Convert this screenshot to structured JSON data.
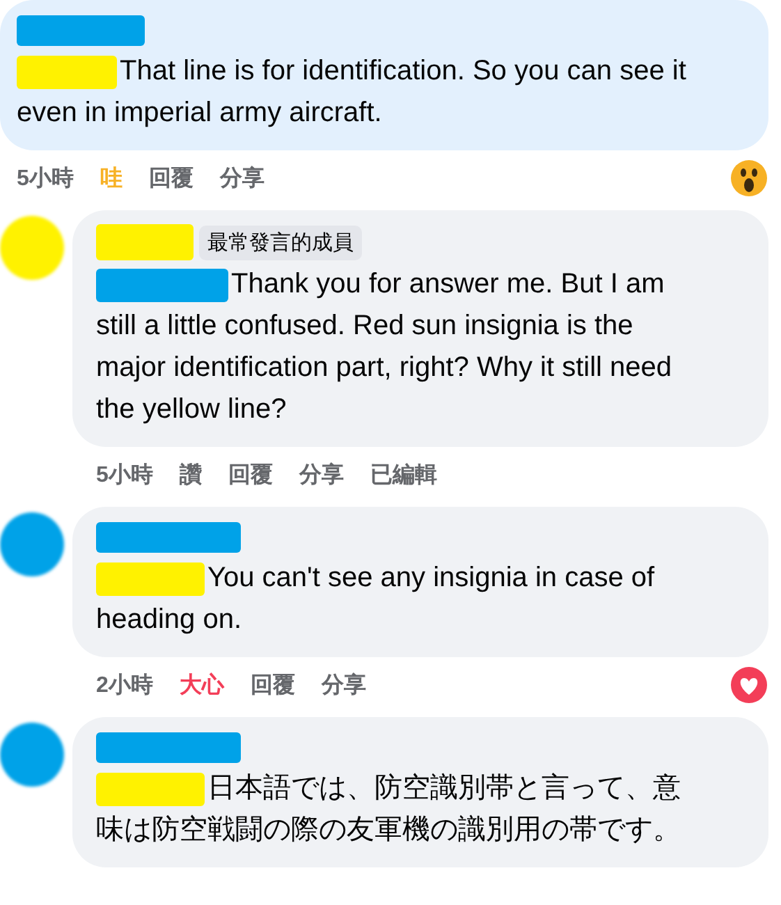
{
  "comments": [
    {
      "highlighted": true,
      "text": "That line is for identification. So you can see it even in imperial army aircraft.",
      "actions": {
        "time": "5小時",
        "reaction": {
          "label": "哇",
          "color": "#f7b125",
          "kind": "wow"
        },
        "reply": "回覆",
        "share": "分享"
      }
    },
    {
      "avatar": {
        "color": "#fff200"
      },
      "badge": "最常發言的成員",
      "highlighted": false,
      "text": "Thank you for answer me. But I am still a little confused. Red sun insignia is the major identification part, right? Why it still need the yellow line?",
      "actions": {
        "time": "5小時",
        "reaction": {
          "label": "讚",
          "color": "#65676b"
        },
        "reply": "回覆",
        "share": "分享",
        "edited": "已編輯"
      }
    },
    {
      "avatar": {
        "color": "#00a2e8"
      },
      "highlighted": false,
      "text": "You can't see any insignia in case of heading on.",
      "actions": {
        "time": "2小時",
        "reaction": {
          "label": "大心",
          "color": "#f33e58",
          "kind": "love"
        },
        "reply": "回覆",
        "share": "分享"
      }
    },
    {
      "avatar": {
        "color": "#00a2e8"
      },
      "highlighted": false,
      "text": "日本語では、防空識別帯と言って、意味は防空戦闘の際の友軍機の識別用の帯です。"
    }
  ]
}
